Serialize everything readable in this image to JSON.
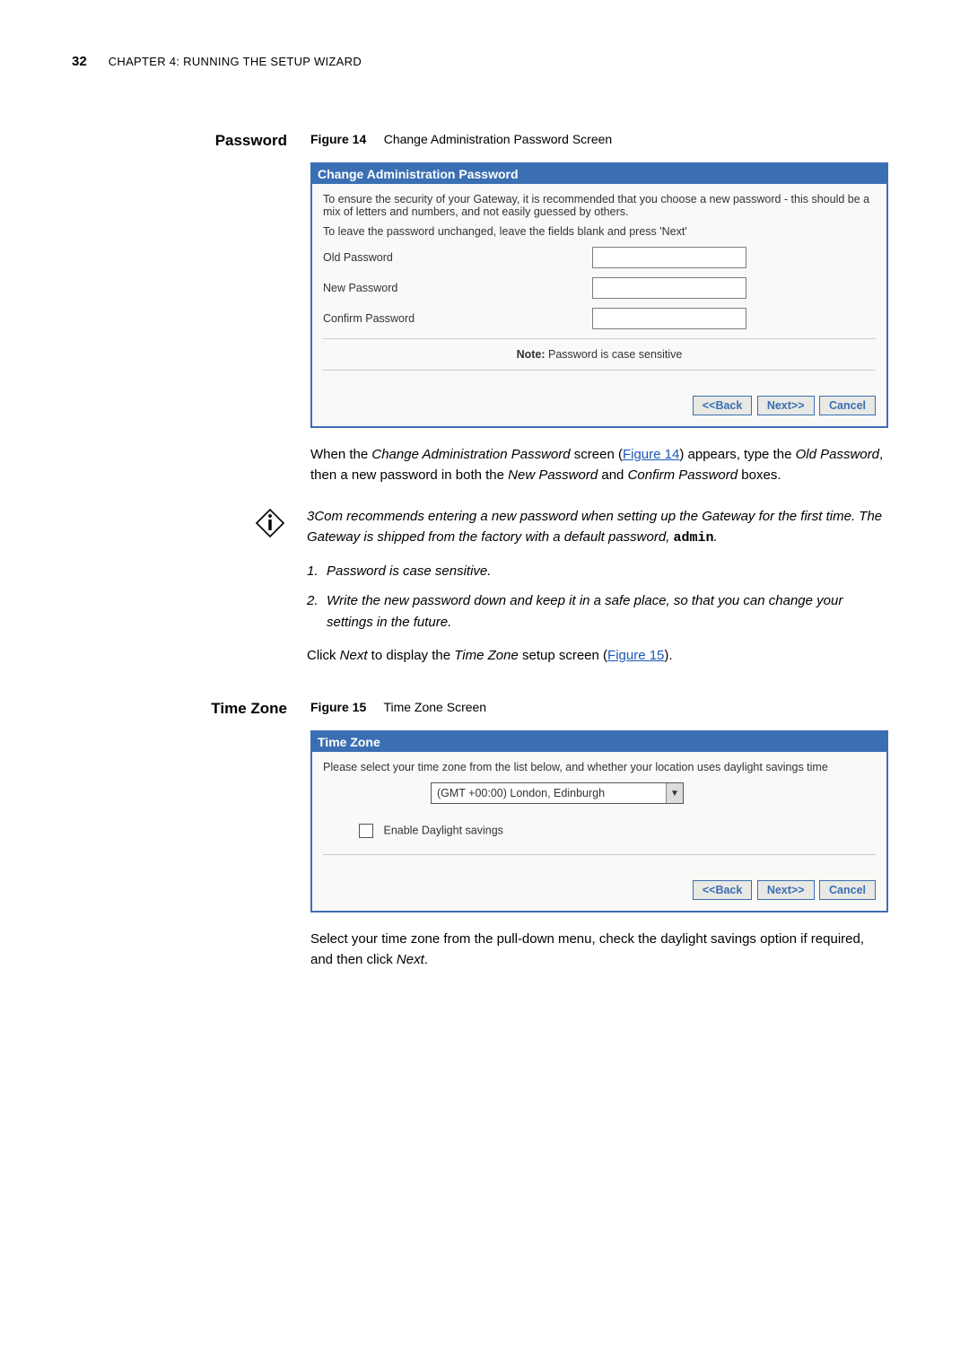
{
  "header": {
    "page_number": "32",
    "chapter": "CHAPTER 4: RUNNING THE SETUP WIZARD"
  },
  "sections": {
    "password": {
      "side_label": "Password",
      "figure_label": "Figure 14",
      "figure_title": "Change Administration Password Screen",
      "panel_title": "Change Administration Password",
      "intro_line": "To ensure the security of your Gateway, it is recommended that you choose a new password - this should be a mix of letters and numbers, and not easily guessed by others.",
      "second_line": "To leave the password unchanged, leave the fields blank and press 'Next'",
      "fields": {
        "old": "Old Password",
        "new": "New Password",
        "confirm": "Confirm Password"
      },
      "note_strong": "Note:",
      "note_text": " Password is case sensitive",
      "buttons": {
        "back": "<<Back",
        "next": "Next>>",
        "cancel": "Cancel"
      },
      "paragraph": {
        "p1_prefix": "When the ",
        "p1_em1": "Change Administration Password",
        "p1_mid1": " screen (",
        "p1_link": "Figure 14",
        "p1_mid2": ") appears, type the ",
        "p1_em2": "Old Password",
        "p1_mid3": ", then a new password in both the ",
        "p1_em3": "New Password",
        "p1_mid4": " and ",
        "p1_em4": "Confirm Password",
        "p1_suffix": " boxes."
      },
      "info_para": {
        "t1": "3Com recommends entering a new password when setting up the Gateway for the first time. The Gateway is shipped from the factory with a default password, ",
        "code": "admin",
        "t2": "."
      },
      "list": {
        "n1": "1.",
        "t1": "Password is case sensitive.",
        "n2": "2.",
        "t2": "Write the new password down and keep it in a safe place, so that you can change your settings in the future."
      },
      "closing": {
        "pref": "Click ",
        "em1": "Next",
        "mid": " to display the ",
        "em2": "Time Zone",
        "mid2": " setup screen (",
        "link": "Figure 15",
        "suf": ")."
      }
    },
    "timezone": {
      "side_label": "Time Zone",
      "figure_label": "Figure 15",
      "figure_title": "Time Zone Screen",
      "panel_title": "Time Zone",
      "intro": "Please select your time zone from the list below, and whether your location uses daylight savings time",
      "select_value": "(GMT +00:00) London, Edinburgh",
      "checkbox_label": "Enable Daylight savings",
      "buttons": {
        "back": "<<Back",
        "next": "Next>>",
        "cancel": "Cancel"
      },
      "closing": {
        "t1": "Select your time zone from the pull-down menu, check the daylight savings option if required, and then click ",
        "em": "Next",
        "t2": "."
      }
    }
  }
}
